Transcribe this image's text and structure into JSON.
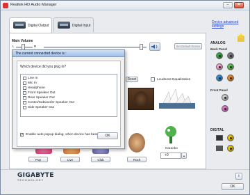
{
  "window": {
    "title": "Realtek HD Audio Manager",
    "minimize_glyph": "–",
    "close_glyph": "✕"
  },
  "tabs": [
    {
      "label": "Digital Output",
      "icon": "speaker-device-icon",
      "active": true
    },
    {
      "label": "Digital Input",
      "icon": "speaker-device-icon",
      "active": false
    }
  ],
  "device_link": "Device advanced settings",
  "main_volume": {
    "label": "Main Volume",
    "left": "L",
    "right": "R",
    "balance": 0.15,
    "level": 0.83
  },
  "set_default_label": "Set Default Device",
  "reset_label": "Reset",
  "loudness_label": "Loudness Equalization",
  "genres": [
    "Pop",
    "Live",
    "Club",
    "Rock"
  ],
  "karaoke": {
    "label": "Karaoke",
    "value": "+0"
  },
  "sidebar": {
    "analog": "ANALOG",
    "back_panel": "Back Panel",
    "front_panel": "Front Panel",
    "digital": "DIGITAL",
    "jack_colors": [
      "#3aa34a",
      "#7a7a7a",
      "#f0a6d2",
      "#5fbf58",
      "#2f8fd6",
      "#e88a2a",
      "#c9c9c9",
      "#d977c8"
    ]
  },
  "brand": {
    "logo": "GIGABYTE",
    "sub": "TECHNOLOGY"
  },
  "footer_ok": "OK",
  "info_icon": "i",
  "dialog": {
    "title": "The current connected device is :",
    "question": "Which device did you plug in?",
    "options": [
      {
        "label": "Line In",
        "checked": false
      },
      {
        "label": "Mic In",
        "checked": false
      },
      {
        "label": "Headphone",
        "checked": false
      },
      {
        "label": "Front Speaker Out",
        "checked": false
      },
      {
        "label": "Rear Speaker Out",
        "checked": false
      },
      {
        "label": "Center/Subwoofer Speaker Out",
        "checked": false
      },
      {
        "label": "Side Speaker Out",
        "checked": false
      }
    ],
    "auto_popup": "Enable auto popup dialog, when device has been plugged in",
    "auto_checked": true,
    "ok": "OK"
  },
  "colors": {
    "link": "#2a44c8",
    "title_bg": "#dfe5ec"
  }
}
